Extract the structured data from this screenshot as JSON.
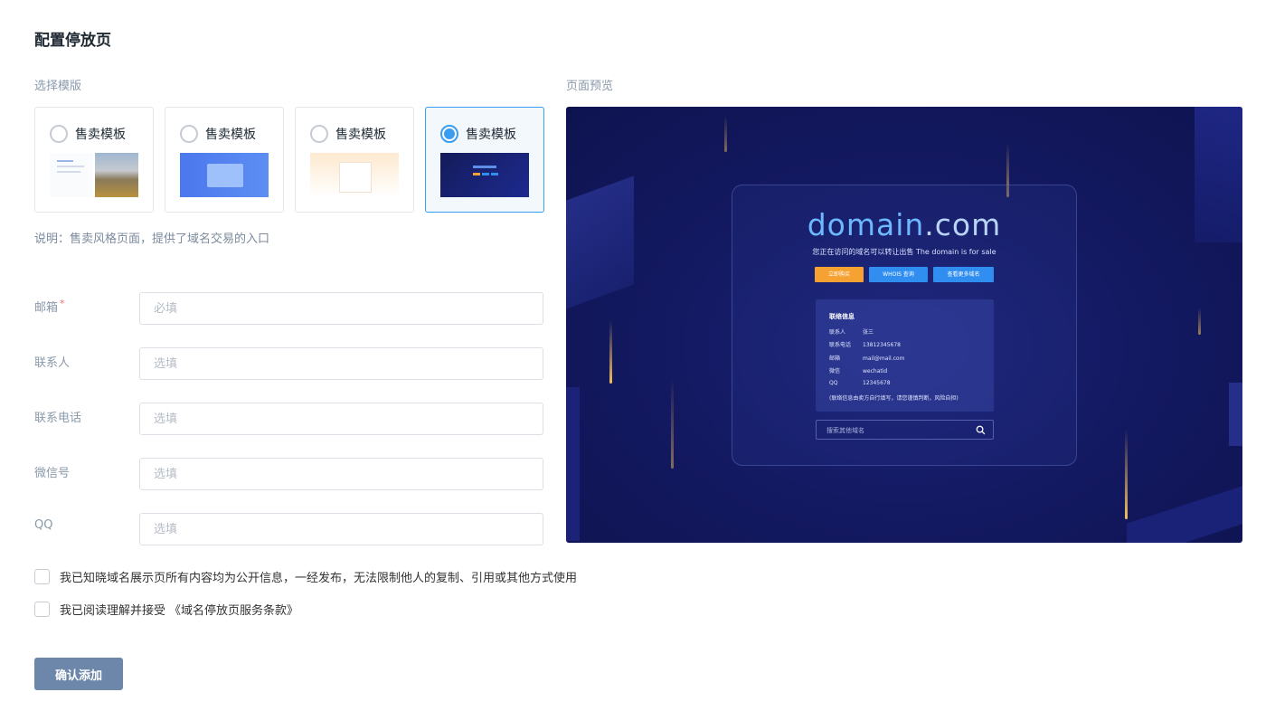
{
  "page": {
    "title": "配置停放页"
  },
  "templates": {
    "section_label": "选择模版",
    "items": [
      {
        "name": "售卖模板",
        "selected": false
      },
      {
        "name": "售卖模板",
        "selected": false
      },
      {
        "name": "售卖模板",
        "selected": false
      },
      {
        "name": "售卖模板",
        "selected": true
      }
    ],
    "note": "说明：售卖风格页面，提供了域名交易的入口"
  },
  "form": {
    "fields": [
      {
        "label": "邮箱",
        "required_mark": "*",
        "placeholder": "必填"
      },
      {
        "label": "联系人",
        "placeholder": "选填"
      },
      {
        "label": "联系电话",
        "placeholder": "选填"
      },
      {
        "label": "微信号",
        "placeholder": "选填"
      },
      {
        "label": "QQ",
        "placeholder": "选填"
      }
    ],
    "agreements": [
      {
        "text": "我已知晓域名展示页所有内容均为公开信息，一经发布，无法限制他人的复制、引用或其他方式使用"
      },
      {
        "text": "我已阅读理解并接受",
        "link": "《域名停放页服务条款》"
      }
    ],
    "submit_label": "确认添加"
  },
  "preview": {
    "section_label": "页面预览",
    "domain_name": "domain",
    "domain_tld": ".com",
    "subtitle": "您正在访问的域名可以转让出售   The domain is for sale",
    "buttons": [
      "立即购买",
      "WHOIS 查询",
      "查看更多域名"
    ],
    "contact": {
      "title": "联络信息",
      "rows": [
        {
          "key": "联系人",
          "value": "张三"
        },
        {
          "key": "联系电话",
          "value": "13812345678"
        },
        {
          "key": "邮箱",
          "value": "mail@mail.com"
        },
        {
          "key": "微信",
          "value": "wechatid"
        },
        {
          "key": "QQ",
          "value": "12345678"
        }
      ],
      "note": "(联络信息由卖方自行填写，请您谨慎判断，风险自担)"
    },
    "search_placeholder": "搜索其他域名"
  },
  "colors": {
    "accent": "#3b9df0",
    "submit_button": "#6d87ab",
    "preview_bg": "#141a63",
    "preview_domain": "#6eb8ff",
    "preview_buy": "#f6a233"
  }
}
